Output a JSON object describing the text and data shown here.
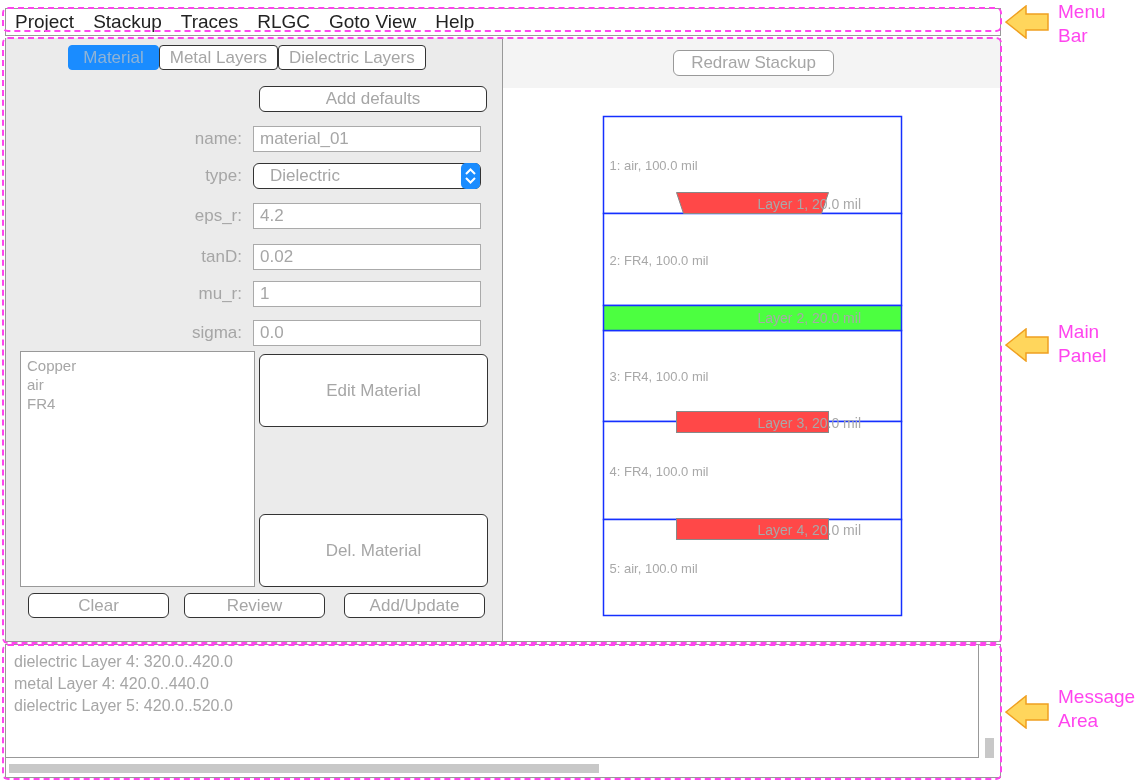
{
  "menu_bar": {
    "items": [
      "Project",
      "Stackup",
      "Traces",
      "RLGC",
      "Goto View",
      "Help"
    ]
  },
  "tabs": [
    {
      "label": "Material",
      "selected": true
    },
    {
      "label": "Metal Layers",
      "selected": false
    },
    {
      "label": "Dielectric Layers",
      "selected": false
    }
  ],
  "material_form": {
    "add_defaults_button": "Add defaults",
    "fields": [
      {
        "kind": "text",
        "label": "name:",
        "value": "material_01"
      },
      {
        "kind": "select",
        "label": "type:",
        "value": "Dielectric"
      },
      {
        "kind": "text",
        "label": "eps_r:",
        "value": "4.2"
      },
      {
        "kind": "text",
        "label": "tanD:",
        "value": "0.02"
      },
      {
        "kind": "text",
        "label": "mu_r:",
        "value": "1"
      },
      {
        "kind": "text",
        "label": "sigma:",
        "value": "0.0"
      }
    ],
    "materials_list": [
      "Copper",
      "air",
      "FR4"
    ],
    "edit_button": "Edit Material",
    "delete_button": "Del. Material",
    "buttons": [
      "Clear",
      "Review",
      "Add/Update"
    ]
  },
  "stackup": {
    "redraw_button": "Redraw Stackup",
    "layers": [
      {
        "kind": "dielectric",
        "label": "1: air, 100.0 mil"
      },
      {
        "kind": "trace",
        "label": "Layer 1, 20.0 mil",
        "color": "#ff4848"
      },
      {
        "kind": "dielectric",
        "label": "2: FR4, 100.0 mil"
      },
      {
        "kind": "plane",
        "label": "Layer 2, 20.0 mil",
        "color": "#4cff40"
      },
      {
        "kind": "dielectric",
        "label": "3: FR4, 100.0 mil"
      },
      {
        "kind": "trace",
        "label": "Layer 3, 20.0 mil",
        "color": "#ff4848"
      },
      {
        "kind": "dielectric",
        "label": "4: FR4, 100.0 mil"
      },
      {
        "kind": "trace",
        "label": "Layer 4, 20.0 mil",
        "color": "#ff4848"
      },
      {
        "kind": "dielectric",
        "label": "5: air, 100.0 mil"
      }
    ]
  },
  "message_area": {
    "lines": [
      "dielectric Layer 4: 320.0..420.0",
      "metal Layer 4: 420.0..440.0",
      "dielectric Layer 5: 420.0..520.0"
    ]
  },
  "annotations": [
    {
      "label": "Menu Bar"
    },
    {
      "label": "Main Panel"
    },
    {
      "label": "Message Area"
    }
  ]
}
